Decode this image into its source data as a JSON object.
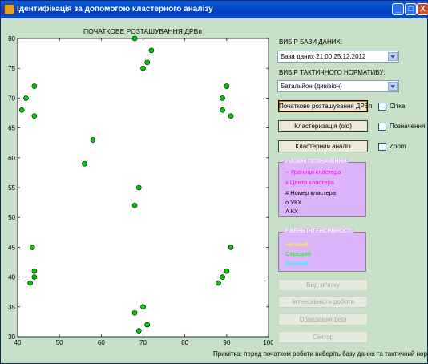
{
  "window": {
    "title": "Ідентифікація за допомогою кластерного аналізу",
    "min_symbol": "_",
    "max_symbol": "□",
    "close_symbol": "X"
  },
  "chart_data": {
    "type": "scatter",
    "title": "ПОЧАТКОВЕ РОЗТАШУВАННЯ ДРВп",
    "xlim": [
      40,
      100
    ],
    "ylim": [
      30,
      80
    ],
    "xticks": [
      40,
      50,
      60,
      70,
      80,
      90,
      100
    ],
    "yticks": [
      30,
      35,
      40,
      45,
      50,
      55,
      60,
      65,
      70,
      75,
      80
    ],
    "grid": false,
    "marker_color": "#00cc00",
    "points": [
      {
        "x": 68,
        "y": 80
      },
      {
        "x": 72,
        "y": 78
      },
      {
        "x": 71,
        "y": 76
      },
      {
        "x": 70,
        "y": 75
      },
      {
        "x": 42,
        "y": 70
      },
      {
        "x": 44,
        "y": 72
      },
      {
        "x": 41,
        "y": 68
      },
      {
        "x": 44,
        "y": 67
      },
      {
        "x": 90,
        "y": 72
      },
      {
        "x": 89,
        "y": 70
      },
      {
        "x": 89,
        "y": 68
      },
      {
        "x": 91,
        "y": 67
      },
      {
        "x": 58,
        "y": 63
      },
      {
        "x": 56,
        "y": 59
      },
      {
        "x": 69,
        "y": 55
      },
      {
        "x": 68,
        "y": 52
      },
      {
        "x": 43.5,
        "y": 45
      },
      {
        "x": 44,
        "y": 41
      },
      {
        "x": 44,
        "y": 40
      },
      {
        "x": 43,
        "y": 39
      },
      {
        "x": 91,
        "y": 45
      },
      {
        "x": 90,
        "y": 41
      },
      {
        "x": 89,
        "y": 40
      },
      {
        "x": 88,
        "y": 39
      },
      {
        "x": 70,
        "y": 35
      },
      {
        "x": 68,
        "y": 34
      },
      {
        "x": 71,
        "y": 32
      },
      {
        "x": 69,
        "y": 31
      }
    ]
  },
  "db": {
    "label": "ВИБІР БАЗИ ДАНИХ:",
    "value": "База даних 21:00 25.12.2012"
  },
  "norm": {
    "label": "ВИБІР ТАКТИЧНОГО НОРМАТИВУ:",
    "value": "Батальйон (дивізіон)"
  },
  "buttons": {
    "initial": "Початкове розташування ДРВп",
    "clustering": "Кластеризація (old)",
    "analysis": "Кластерний аналіз",
    "link_type": "Вид зв'язку",
    "intensity": "Інтенсивність роботи",
    "beta": "Обведення beta",
    "sector": "Сектор"
  },
  "checkboxes": {
    "grid": "Сітка",
    "labels": "Позначення",
    "zoom": "Zoom"
  },
  "legend": {
    "title": "УМОВНІ ПОЗНАЧЕННЯ",
    "items": [
      {
        "text": "-- Границя кластера",
        "color": "#ff00ff"
      },
      {
        "text": "x Центр кластера",
        "color": "#ff00ff"
      },
      {
        "text": "# Номер кластера",
        "color": "#000000"
      },
      {
        "text": "o УКХ",
        "color": "#000000"
      },
      {
        "text": "Λ КХ",
        "color": "#000000"
      }
    ]
  },
  "intensity": {
    "title": "РІВЕНЬ ІНТЕНСИВНОСТІ",
    "items": [
      {
        "text": "Низький",
        "color": "#ffff00"
      },
      {
        "text": "Середній",
        "color": "#00ff00"
      },
      {
        "text": "Високий",
        "color": "#00ffff"
      }
    ]
  },
  "note": "Примітка: перед початком роботи виберіть базу даних та тактичний норматив"
}
